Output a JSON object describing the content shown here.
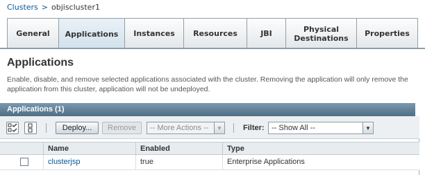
{
  "breadcrumb": {
    "parent": "Clusters",
    "separator": ">",
    "current": "objiscluster1"
  },
  "tabs": [
    {
      "label": "General",
      "selected": false
    },
    {
      "label": "Applications",
      "selected": true
    },
    {
      "label": "Instances",
      "selected": false
    },
    {
      "label": "Resources",
      "selected": false
    },
    {
      "label": "JBI",
      "selected": false
    },
    {
      "label": "Physical Destinations",
      "selected": false
    },
    {
      "label": "Properties",
      "selected": false
    }
  ],
  "page": {
    "title": "Applications",
    "help": "Enable, disable, and remove selected applications associated with the cluster. Removing the application will only remove the application from this cluster, application will not be undeployed."
  },
  "table": {
    "title": "Applications (1)",
    "actions": {
      "deploy": "Deploy...",
      "remove": "Remove",
      "more_actions": "-- More Actions --",
      "filter_label": "Filter:",
      "filter_value": "-- Show All --"
    },
    "columns": [
      "Name",
      "Enabled",
      "Type"
    ],
    "rows": [
      {
        "name": "clusterjsp",
        "enabled": "true",
        "type": "Enterprise Applications",
        "checked": false
      }
    ]
  },
  "icons": {
    "select_all": "select-all-icon",
    "deselect_all": "deselect-all-icon"
  },
  "colors": {
    "link": "#035899",
    "table_title_bg": "#4e6f86"
  }
}
